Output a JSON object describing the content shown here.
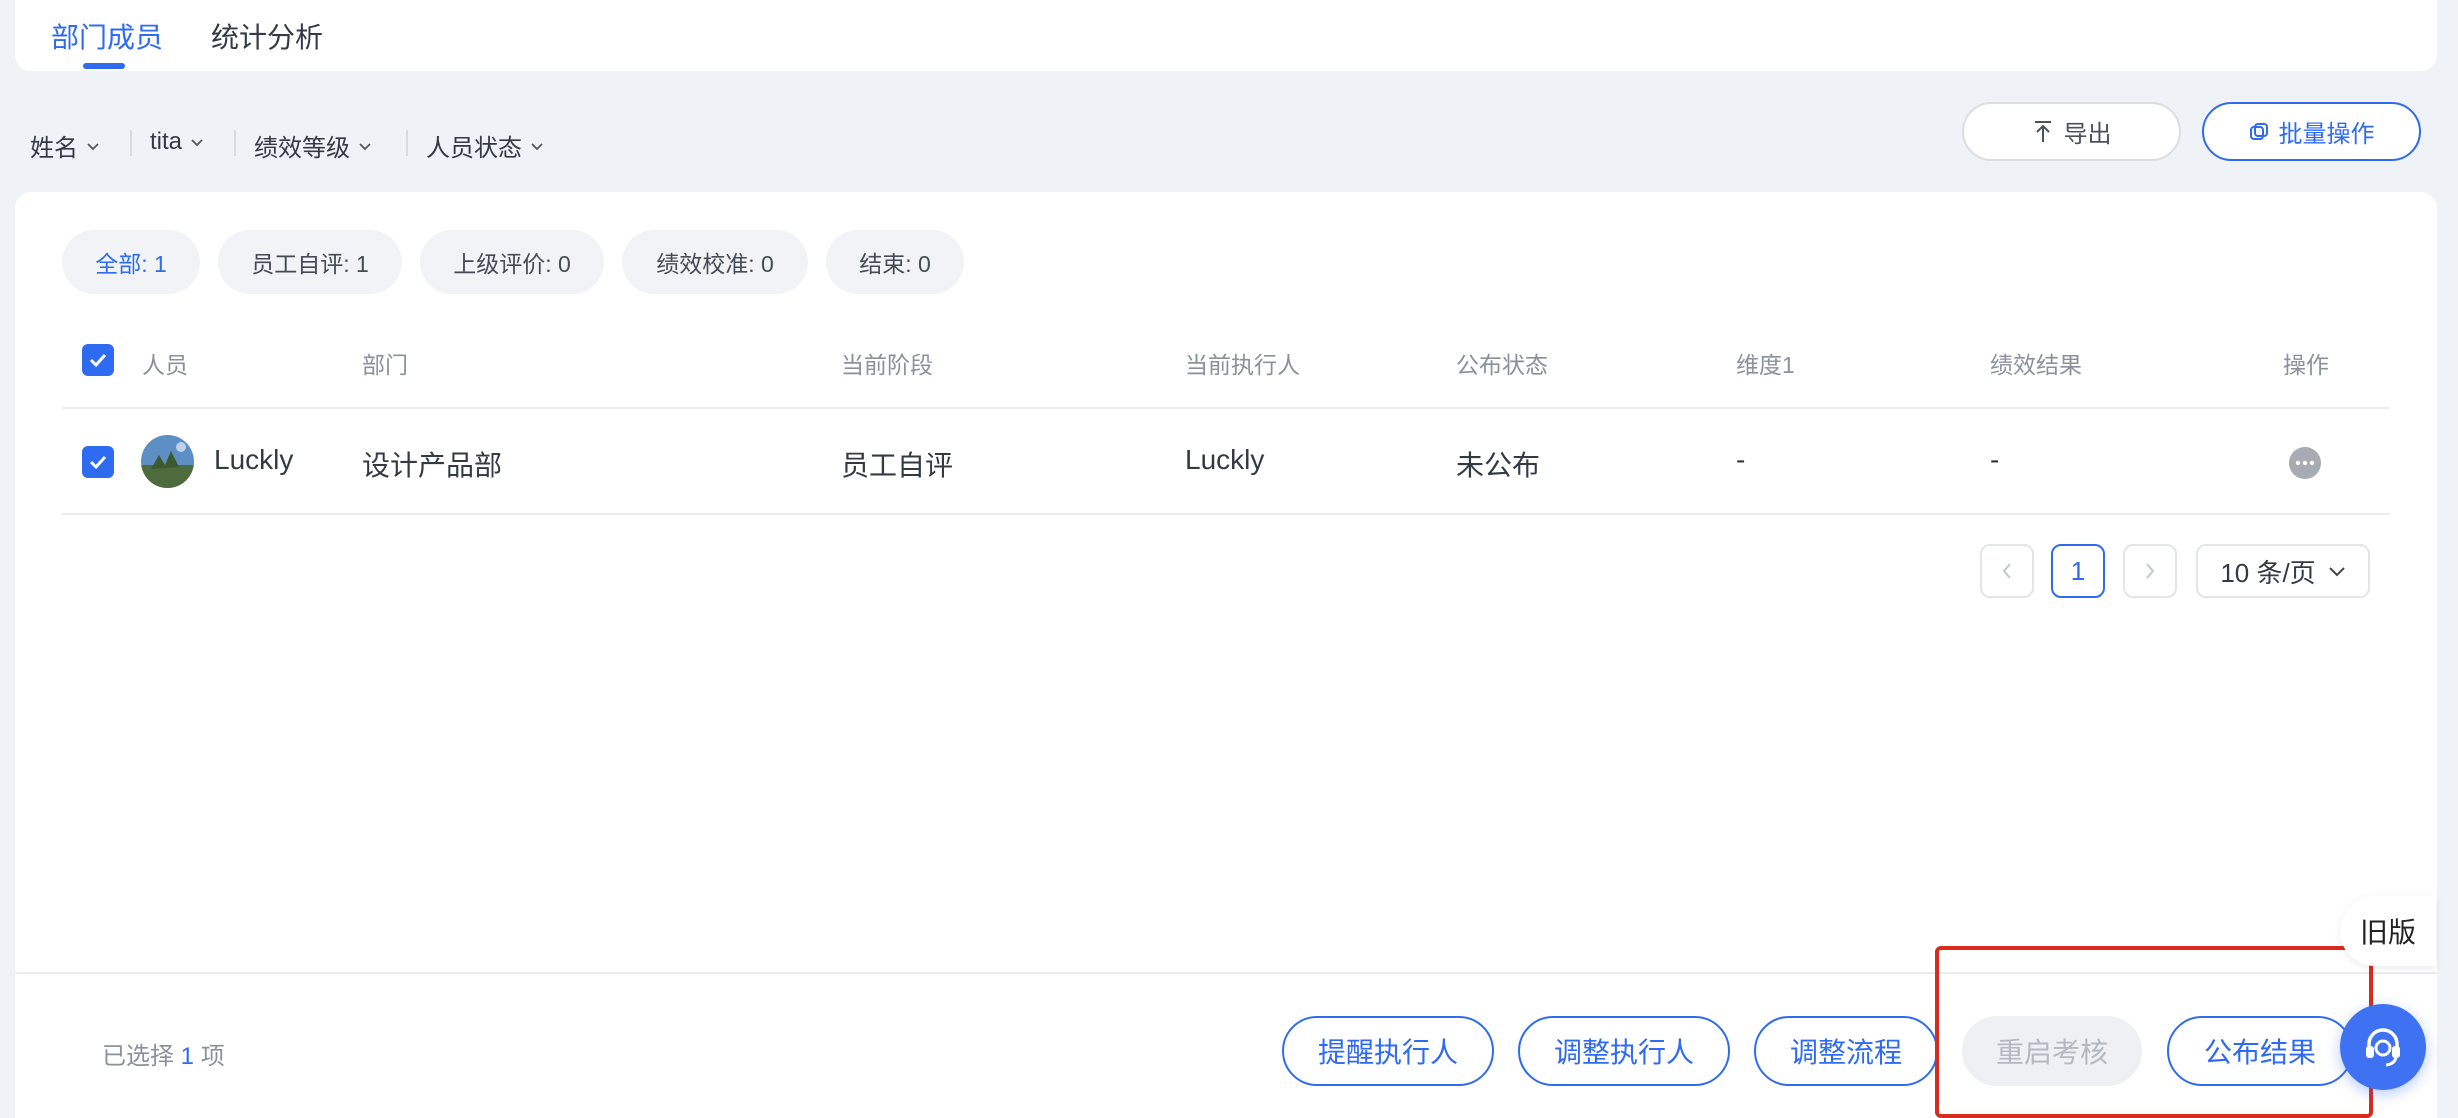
{
  "tabs": [
    {
      "label": "部门成员",
      "active": true
    },
    {
      "label": "统计分析",
      "active": false
    }
  ],
  "filters": [
    "姓名",
    "tita",
    "绩效等级",
    "人员状态"
  ],
  "toolbar": {
    "export_label": "导出",
    "batch_label": "批量操作"
  },
  "status_chips": [
    {
      "label": "全部: 1",
      "active": true
    },
    {
      "label": "员工自评: 1",
      "active": false
    },
    {
      "label": "上级评价: 0",
      "active": false
    },
    {
      "label": "绩效校准: 0",
      "active": false
    },
    {
      "label": "结束: 0",
      "active": false
    }
  ],
  "table": {
    "headers": {
      "person": "人员",
      "department": "部门",
      "stage": "当前阶段",
      "executor": "当前执行人",
      "publish_status": "公布状态",
      "dimension": "维度1",
      "result": "绩效结果",
      "actions": "操作"
    },
    "rows": [
      {
        "name": "Luckly",
        "department": "设计产品部",
        "stage": "员工自评",
        "executor": "Luckly",
        "publish_status": "未公布",
        "dimension": "-",
        "result": "-",
        "checked": true
      }
    ]
  },
  "pagination": {
    "current_page": "1",
    "page_size": "10 条/页"
  },
  "footer": {
    "selected_prefix": "已选择",
    "selected_count": "1",
    "selected_suffix": "项",
    "buttons": {
      "remind": "提醒执行人",
      "adjust_executor": "调整执行人",
      "adjust_flow": "调整流程",
      "restart": "重启考核",
      "publish": "公布结果"
    }
  },
  "old_version_label": "旧版",
  "colors": {
    "accent": "#2f6bf0",
    "highlight": "#d92b1e"
  }
}
